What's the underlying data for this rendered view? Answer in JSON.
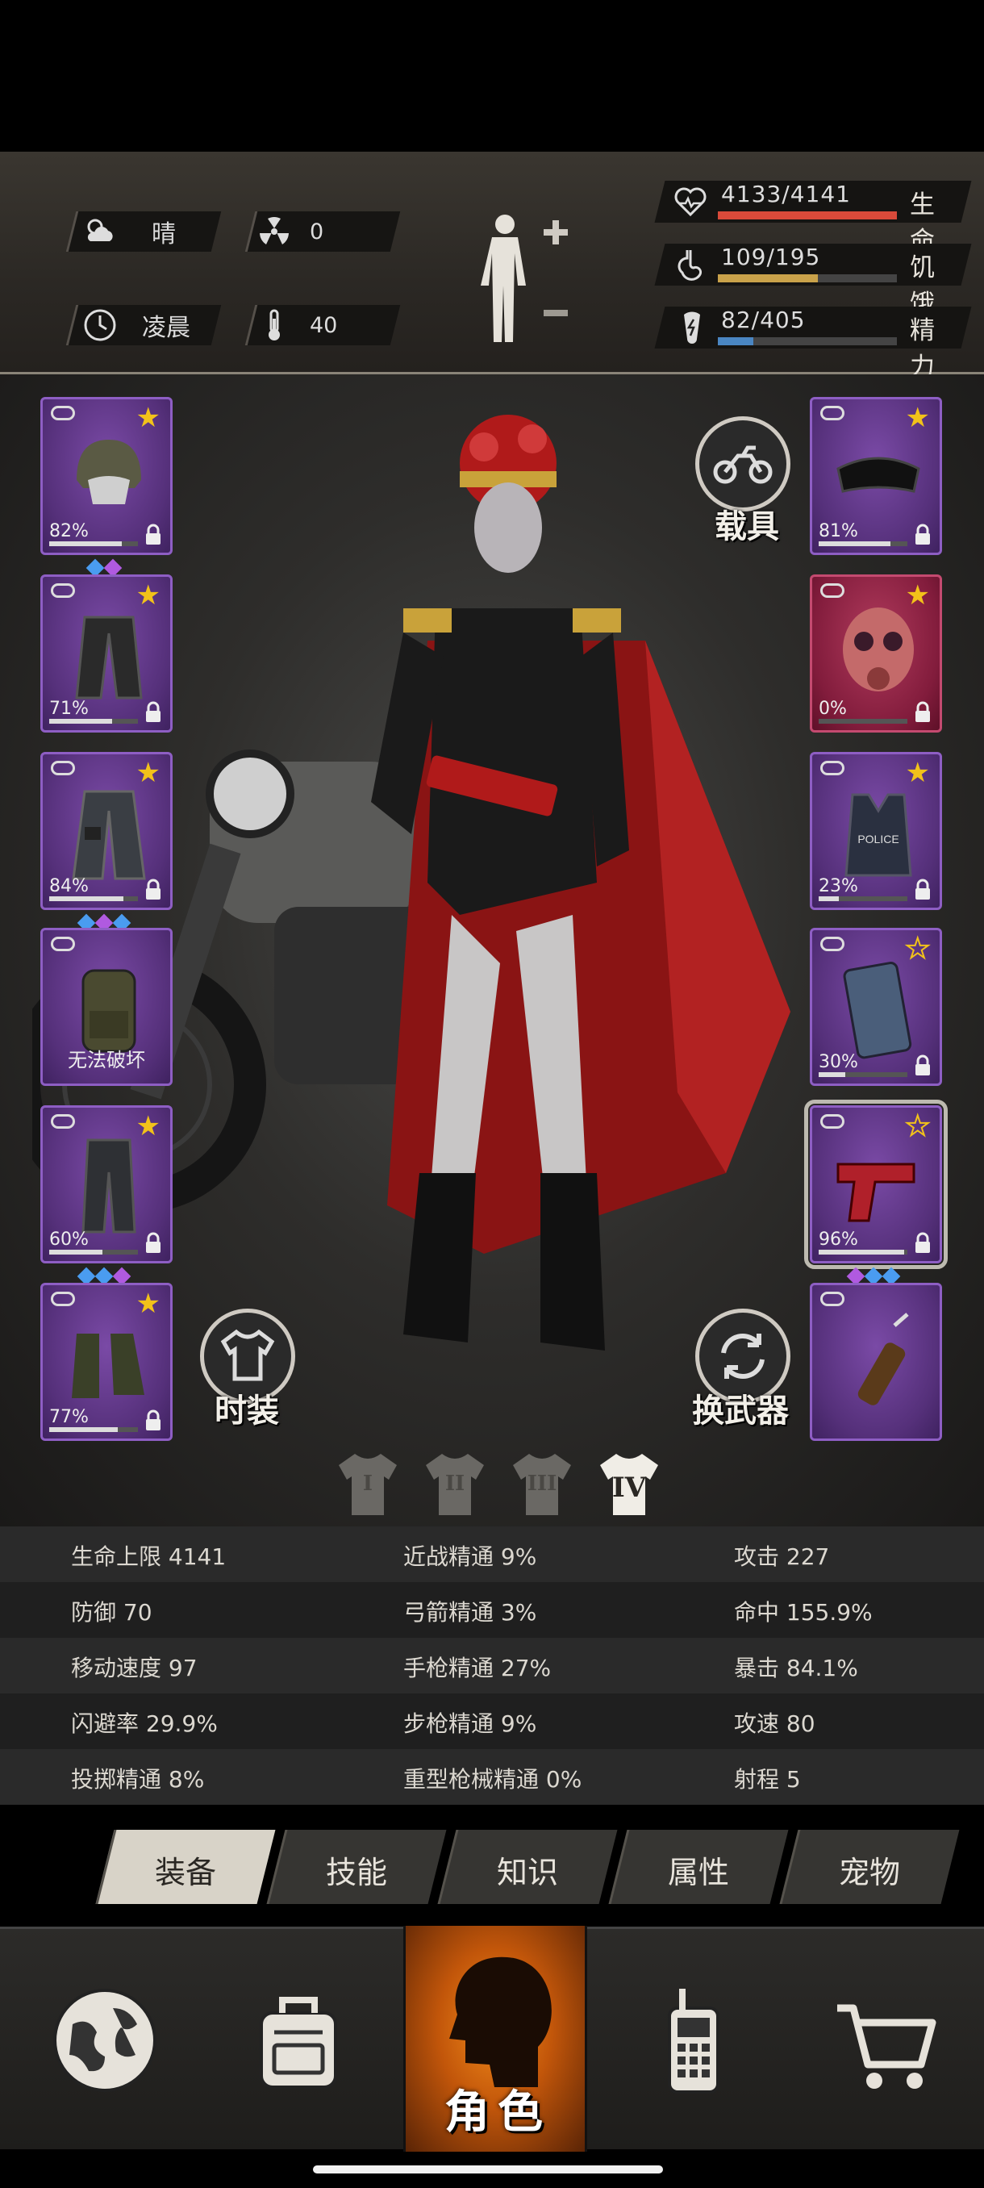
{
  "status": {
    "weather": "晴",
    "radiation": "0",
    "time_of_day": "凌晨",
    "temperature": "40"
  },
  "vitals": {
    "health": {
      "text": "4133/4141",
      "label": "生命",
      "fill": 0.998,
      "color": "#d94a3a"
    },
    "hunger": {
      "text": "109/195",
      "label": "饥饿",
      "fill": 0.56,
      "color": "#c9a24a"
    },
    "energy": {
      "text": "82/405",
      "label": "精力",
      "fill": 0.2,
      "color": "#4a86c2"
    }
  },
  "left_slots": [
    {
      "item": "helmet-icon",
      "percent": "82%",
      "durability": 0.82,
      "star": true,
      "gems": [
        "#4a9cf0",
        "#b05ae0"
      ],
      "color": "purple"
    },
    {
      "item": "jacket-icon",
      "percent": "71%",
      "durability": 0.71,
      "star": true,
      "gems": [],
      "color": "purple"
    },
    {
      "item": "coat-icon",
      "percent": "84%",
      "durability": 0.84,
      "star": true,
      "gems": [
        "#4a9cf0",
        "#b05ae0",
        "#4a9cf0"
      ],
      "color": "purple"
    },
    {
      "item": "backpack-icon",
      "percent": "",
      "unbreakable": "无法破坏",
      "star": false,
      "gems": [],
      "color": "purple"
    },
    {
      "item": "pants-icon",
      "percent": "60%",
      "durability": 0.6,
      "star": true,
      "gems": [
        "#4a9cf0",
        "#4a9cf0",
        "#b05ae0"
      ],
      "color": "purple"
    },
    {
      "item": "boots-icon",
      "percent": "77%",
      "durability": 0.77,
      "star": true,
      "gems": [],
      "color": "purple"
    }
  ],
  "right_slots": [
    {
      "item": "goggles-icon",
      "percent": "81%",
      "durability": 0.81,
      "star": true,
      "color": "purple"
    },
    {
      "item": "gas-mask-icon",
      "percent": "0%",
      "durability": 0.0,
      "star": true,
      "color": "red"
    },
    {
      "item": "police-vest-icon",
      "percent": "23%",
      "durability": 0.23,
      "star": true,
      "color": "purple"
    },
    {
      "item": "riot-shield-icon",
      "percent": "30%",
      "durability": 0.3,
      "star": "hollow",
      "color": "purple"
    },
    {
      "item": "pistol-icon",
      "percent": "96%",
      "durability": 0.96,
      "star": "hollow",
      "color": "purple",
      "selected": true,
      "gems": [
        "#b05ae0",
        "#4a9cf0",
        "#4a9cf0"
      ]
    },
    {
      "item": "molotov-icon",
      "percent": "",
      "star": false,
      "color": "purple"
    }
  ],
  "buttons": {
    "vehicle": "载具",
    "fashion": "时装",
    "switch_weapon": "换武器"
  },
  "outfit_tabs": [
    "I",
    "II",
    "III",
    "IV"
  ],
  "attributes": [
    [
      "生命上限 4141",
      "近战精通 9%",
      "攻击 227"
    ],
    [
      "防御 70",
      "弓箭精通 3%",
      "命中 155.9%"
    ],
    [
      "移动速度 97",
      "手枪精通 27%",
      "暴击 84.1%"
    ],
    [
      "闪避率 29.9%",
      "步枪精通 9%",
      "攻速 80"
    ],
    [
      "投掷精通 8%",
      "重型枪械精通 0%",
      "射程 5"
    ]
  ],
  "sub_tabs": [
    "装备",
    "技能",
    "知识",
    "属性",
    "宠物"
  ],
  "bottom_nav": {
    "center_label": "角色"
  }
}
